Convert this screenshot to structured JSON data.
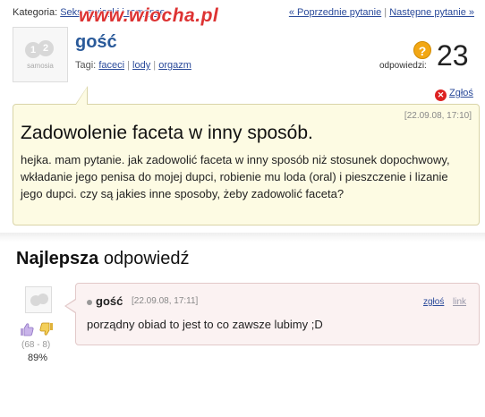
{
  "breadcrumb": {
    "prefix": "Kategoria:",
    "category": "Seks, związki i romanse"
  },
  "nav": {
    "prev": "« Poprzednie pytanie",
    "sep": "|",
    "next": "Następne pytanie »"
  },
  "watermark": "www.wiocha.pl",
  "avatar": {
    "digits": [
      "1",
      "2"
    ],
    "wordmark": "samosia"
  },
  "question": {
    "author": "gość",
    "tags_label": "Tagi:",
    "tags": [
      "faceci",
      "lody",
      "orgazm"
    ],
    "answers_label": "odpowiedzi:",
    "answers_count": "23",
    "report_label": "Zgłoś",
    "date": "[22.09.08, 17:10]",
    "title": "Zadowolenie faceta w inny sposób.",
    "body": "hejka. mam pytanie. jak zadowolić faceta w inny sposób niż stosunek dopochwowy, wkładanie jego penisa do mojej dupci, robienie mu loda (oral) i pieszczenie i lizanie jego dupci. czy są jakies inne sposoby, żeby zadowolić faceta?"
  },
  "best_answer": {
    "heading_bold": "Najlepsza",
    "heading_rest": "odpowiedź",
    "author": "gość",
    "date": "[22.09.08, 17:11]",
    "report_label": "zgłoś",
    "link_label": "link",
    "body": "porządny obiad to jest to co zawsze lubimy ;D",
    "votes": "(68 - 8)",
    "percent": "89%"
  },
  "colors": {
    "question_bg": "#fdfbe3",
    "answer_bg": "#fbf2f2",
    "author_blue": "#2a5a9a",
    "badge_orange": "#f2a714",
    "report_red": "#d22222"
  },
  "icons": [
    "question-mark-icon",
    "report-x-icon",
    "thumbs-up-icon",
    "thumbs-down-icon",
    "bullet-dot-icon"
  ]
}
